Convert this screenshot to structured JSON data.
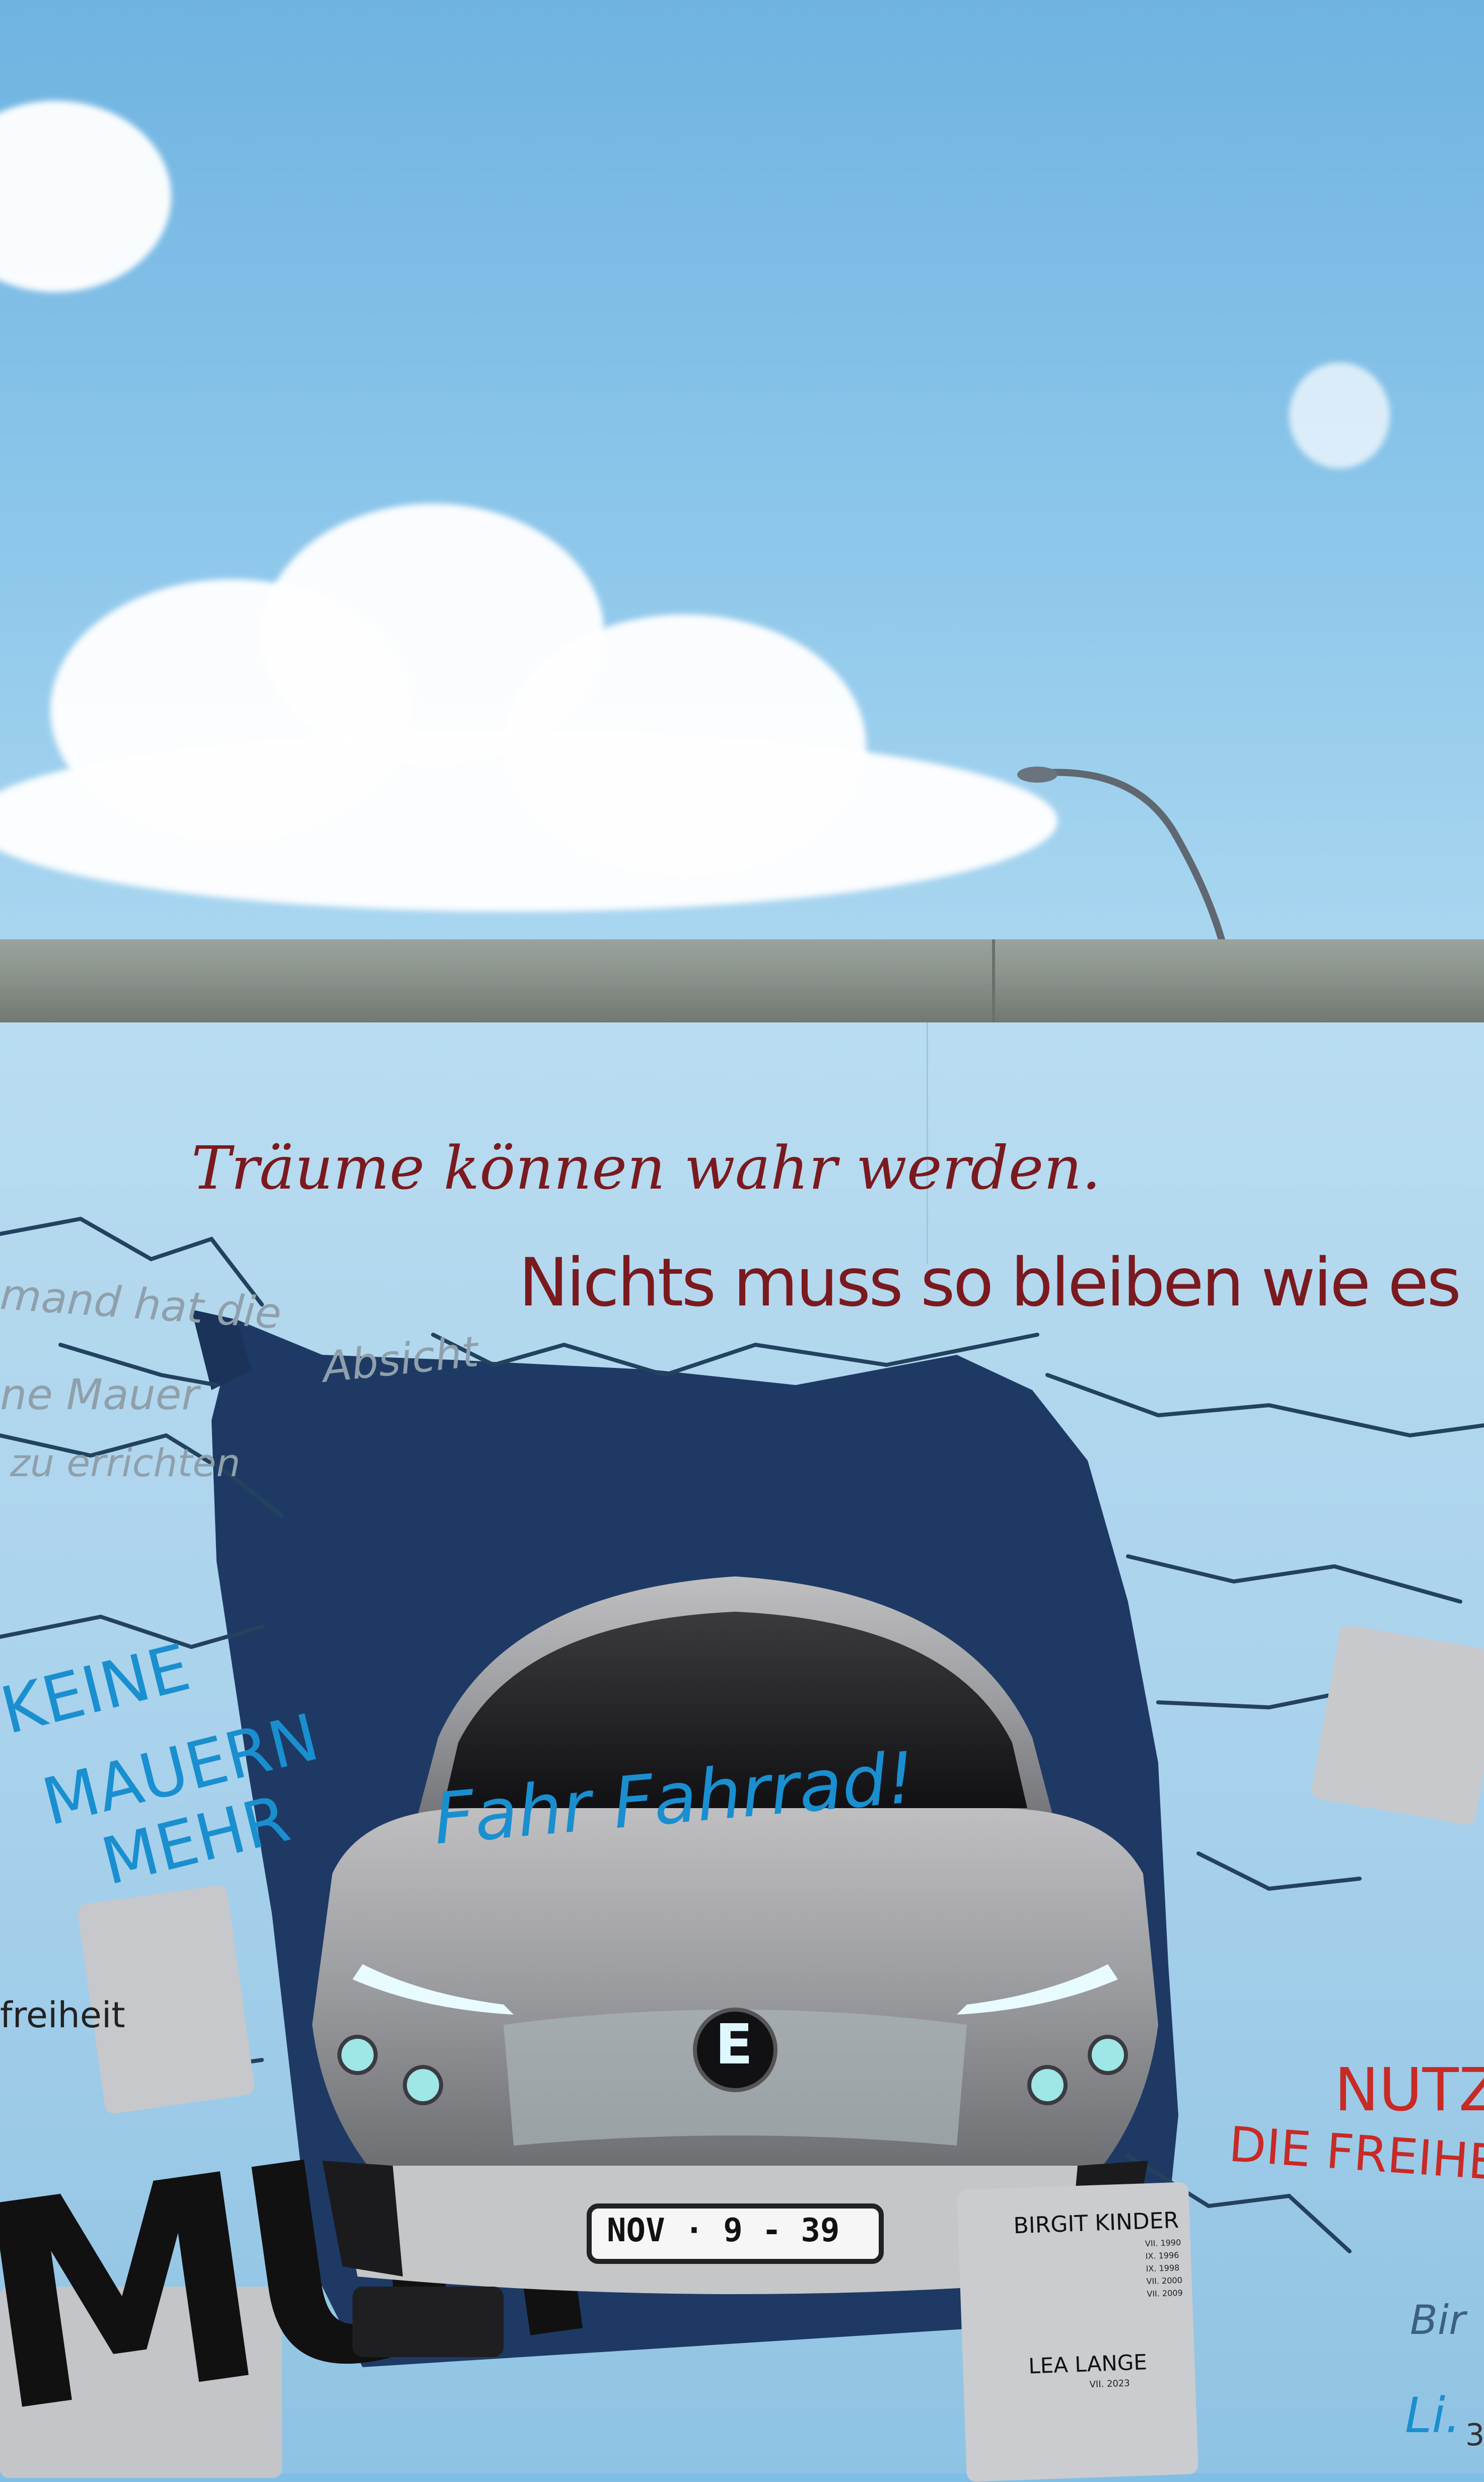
{
  "wall_texts": {
    "line1": "Träume können wahr werden.",
    "line2": "Nichts muss so bleiben wie es",
    "faded1": "mand hat die",
    "faded2": "Absicht",
    "faded3": "ne Mauer",
    "faded4": "zu errichten",
    "keine": "KEINE",
    "mauern": "MAUERN",
    "mehr": "MEHR",
    "freiheit": "freiheit",
    "nutz": "NUTZ",
    "die_freihe": "DIE FREIHE",
    "mut": "MUT",
    "fahr_fahrrad": "Fahr Fahrrad!",
    "sig_b": "Bir",
    "sig_l": "Li.",
    "sig_num": "3"
  },
  "car": {
    "emblem": "E",
    "plate": "NOV · 9 - 39"
  },
  "sticker": {
    "name1": "BIRGIT KINDER",
    "dates": [
      "VII. 1990",
      "IX. 1996",
      "IX. 1998",
      "VII. 2000",
      "VII. 2009"
    ],
    "name2": "LEA LANGE",
    "date2": "VII. 2023"
  },
  "colors": {
    "sky": "#7fbfe6",
    "wall": "#a9d2ec",
    "hole": "#1e3a64",
    "text_red": "#7a1a1f",
    "text_blue": "#1a8fd0",
    "text_faded": "#8fa0ab",
    "nutz_red": "#c82a25"
  }
}
